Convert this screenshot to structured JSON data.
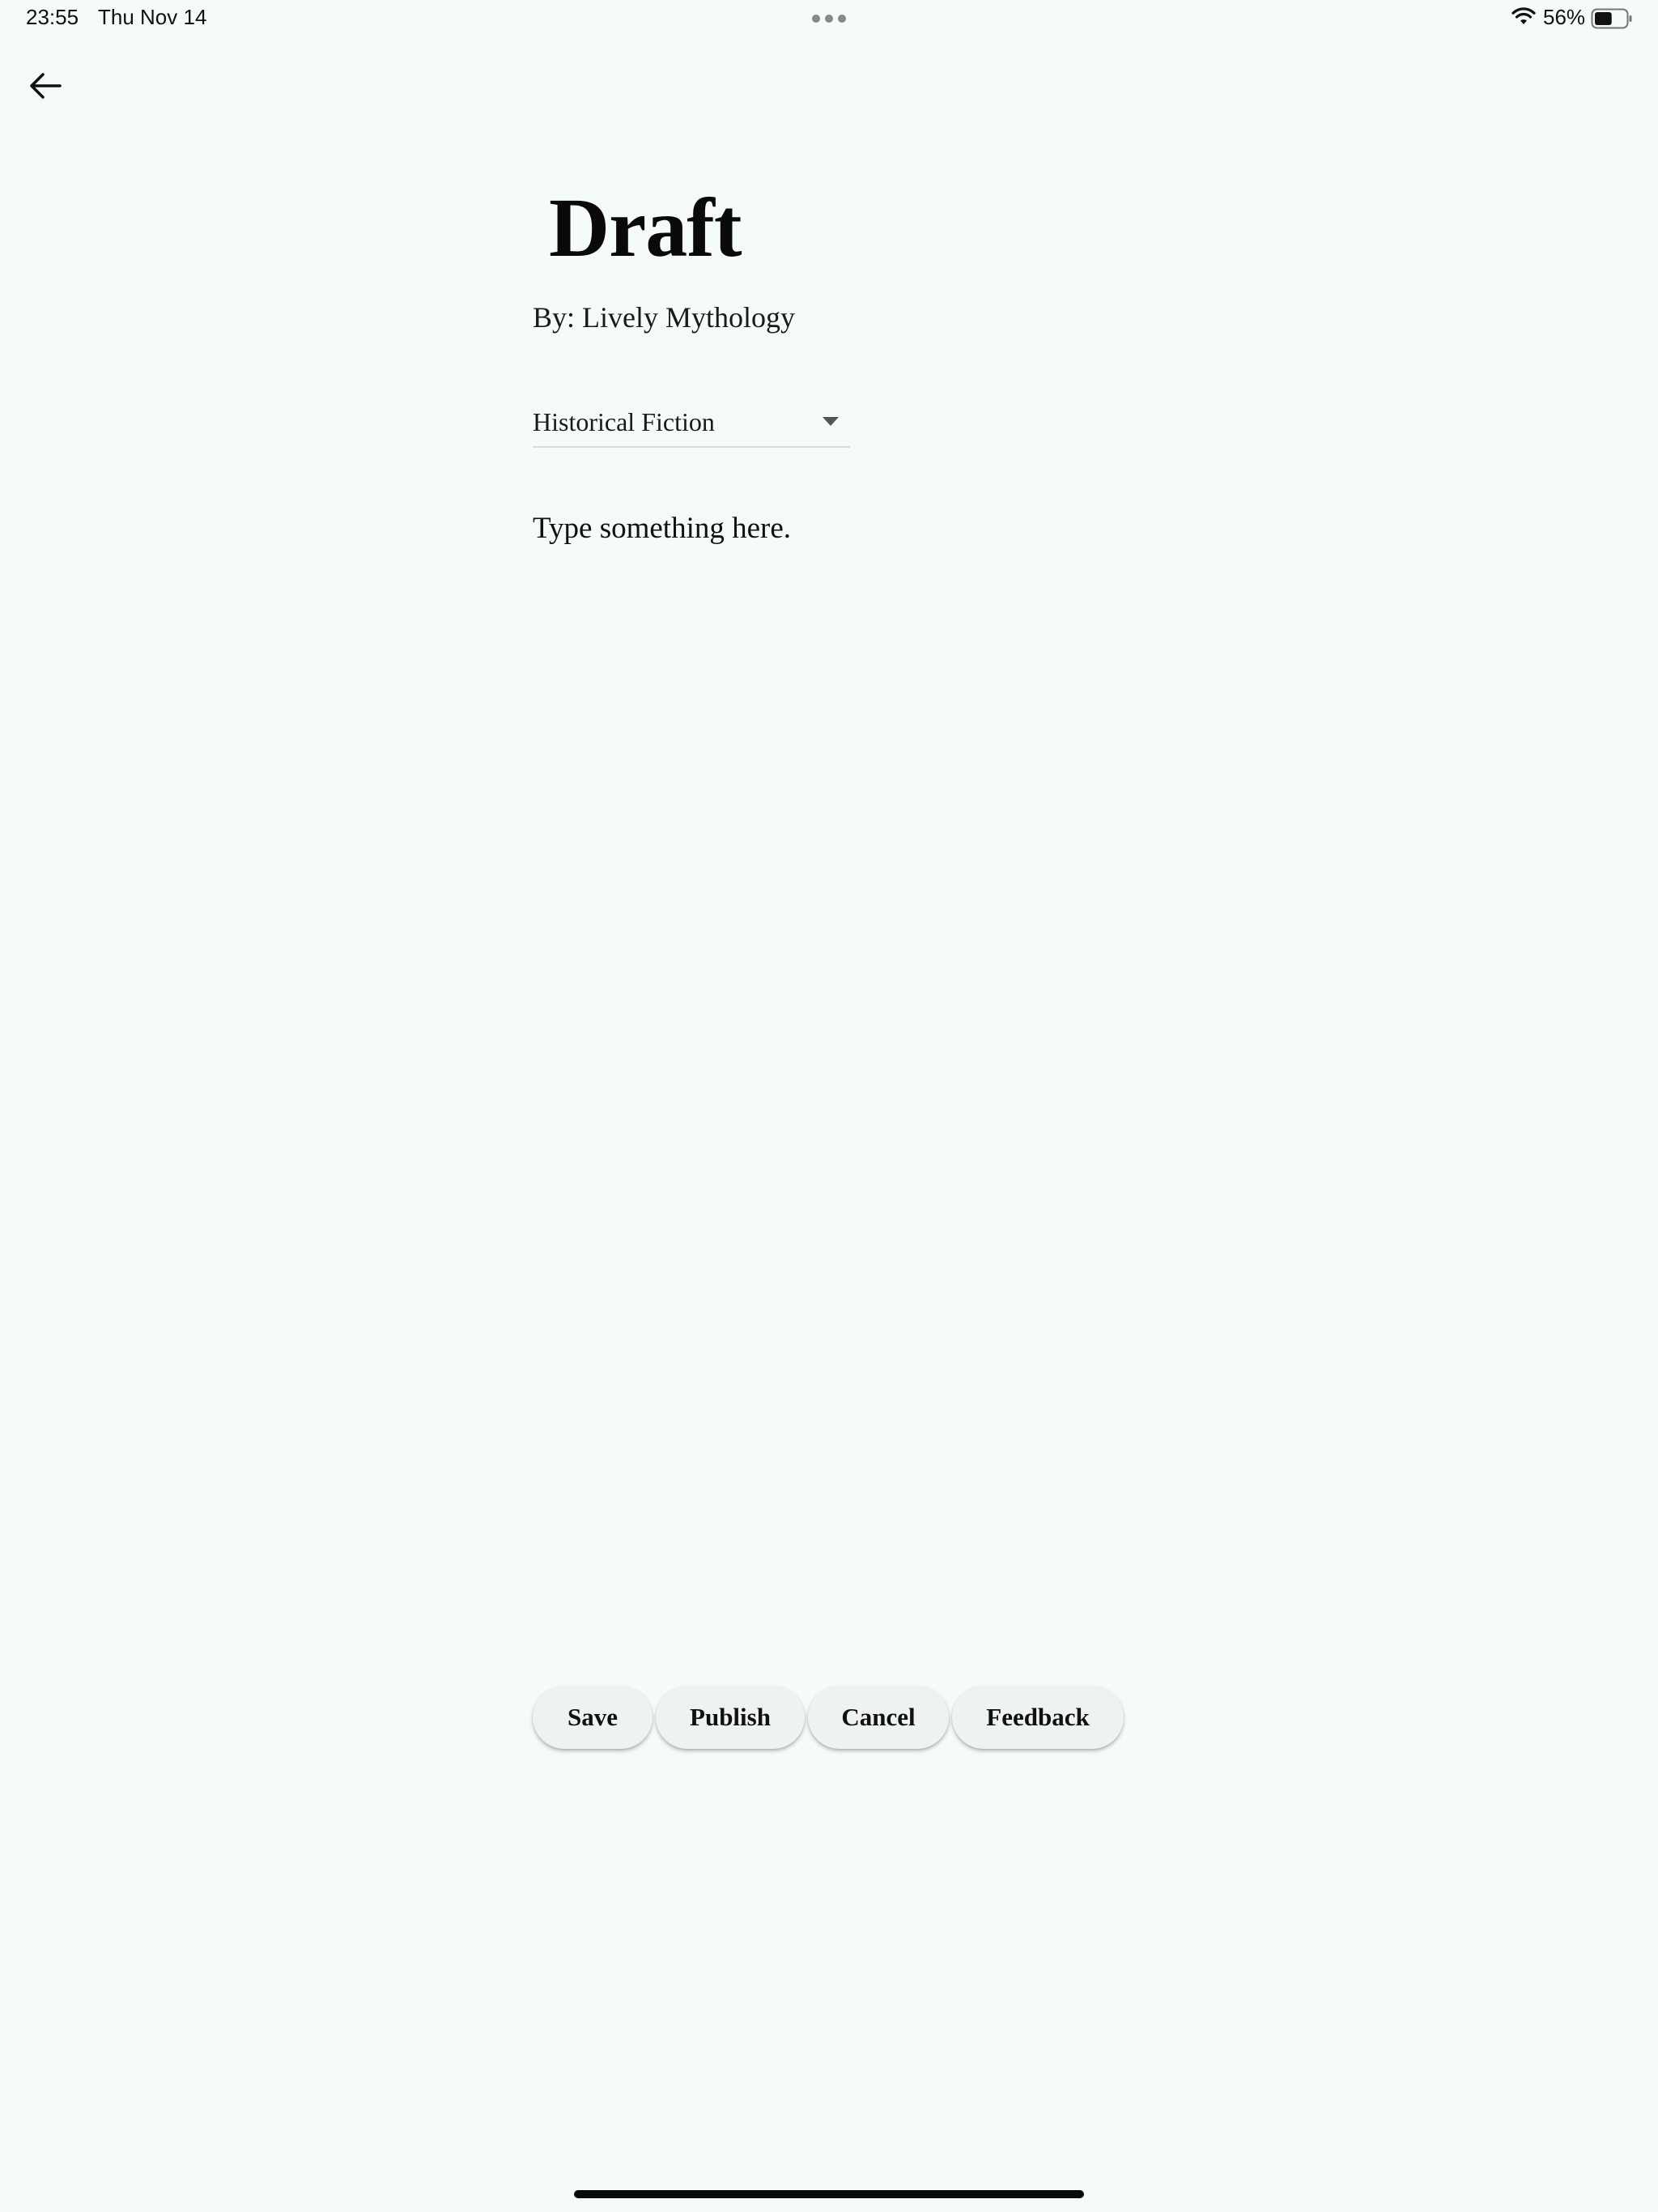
{
  "status_bar": {
    "time": "23:55",
    "date": "Thu Nov 14",
    "battery_percent": "56%",
    "battery_level": 0.56
  },
  "header": {
    "title": "Draft",
    "author_line": "By: Lively Mythology"
  },
  "genre_select": {
    "selected": "Historical Fiction"
  },
  "editor": {
    "placeholder": "Type something here.",
    "value": ""
  },
  "actions": {
    "save": "Save",
    "publish": "Publish",
    "cancel": "Cancel",
    "feedback": "Feedback"
  },
  "icons": {
    "back": "arrow-left-icon",
    "wifi": "wifi-icon",
    "battery": "battery-icon",
    "dropdown": "chevron-down-icon",
    "multitask": "more-dots-icon"
  }
}
